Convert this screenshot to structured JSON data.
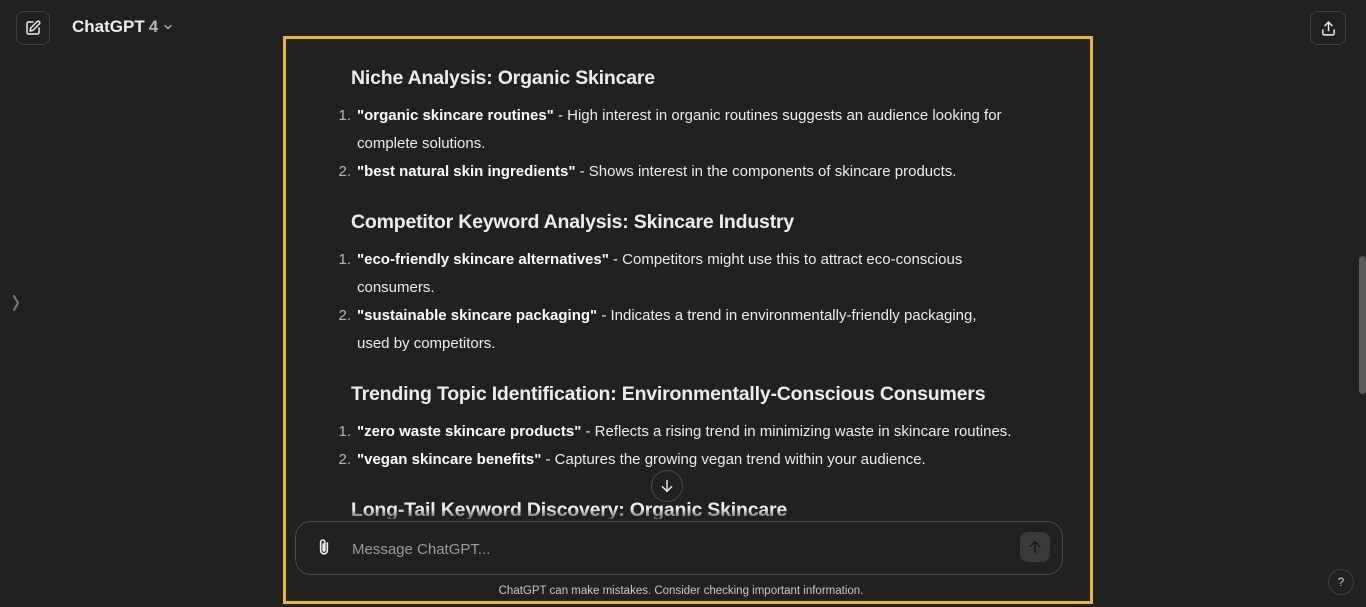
{
  "header": {
    "model_name": "ChatGPT",
    "model_version": "4"
  },
  "sections": [
    {
      "heading": "Niche Analysis: Organic Skincare",
      "items": [
        {
          "num": "1.",
          "keyword": "\"organic skincare routines\"",
          "desc_line1": " - High interest in organic routines suggests an audience looking for",
          "desc_line2": "complete solutions."
        },
        {
          "num": "2.",
          "keyword": "\"best natural skin ingredients\"",
          "desc_line1": " - Shows interest in the components of skincare products.",
          "desc_line2": ""
        }
      ]
    },
    {
      "heading": "Competitor Keyword Analysis: Skincare Industry",
      "items": [
        {
          "num": "1.",
          "keyword": "\"eco-friendly skincare alternatives\"",
          "desc_line1": " - Competitors might use this to attract eco-conscious",
          "desc_line2": "consumers."
        },
        {
          "num": "2.",
          "keyword": "\"sustainable skincare packaging\"",
          "desc_line1": " - Indicates a trend in environmentally-friendly packaging,",
          "desc_line2": "used by competitors."
        }
      ]
    },
    {
      "heading": "Trending Topic Identification: Environmentally-Conscious Consumers",
      "items": [
        {
          "num": "1.",
          "keyword": "\"zero waste skincare products\"",
          "desc_line1": " - Reflects a rising trend in minimizing waste in skincare routines.",
          "desc_line2": ""
        },
        {
          "num": "2.",
          "keyword": "\"vegan skincare benefits\"",
          "desc_line1": " - Captures the growing vegan trend within your audience.",
          "desc_line2": ""
        }
      ]
    },
    {
      "heading": "Long-Tail Keyword Discovery: Organic Skincare",
      "items": []
    }
  ],
  "composer": {
    "placeholder": "Message ChatGPT..."
  },
  "footer": {
    "disclaimer": "ChatGPT can make mistakes. Consider checking important information."
  },
  "help": {
    "label": "?"
  },
  "icons": {
    "new_chat": "new-chat-icon",
    "chevron": "chevron-down-icon",
    "share": "share-icon",
    "sidebar": "sidebar-toggle-icon",
    "scroll_down": "arrow-down-icon",
    "attach": "paperclip-icon",
    "send": "arrow-up-icon"
  },
  "colors": {
    "background": "#212121",
    "highlight": "#f0b429",
    "text": "#ececec"
  }
}
